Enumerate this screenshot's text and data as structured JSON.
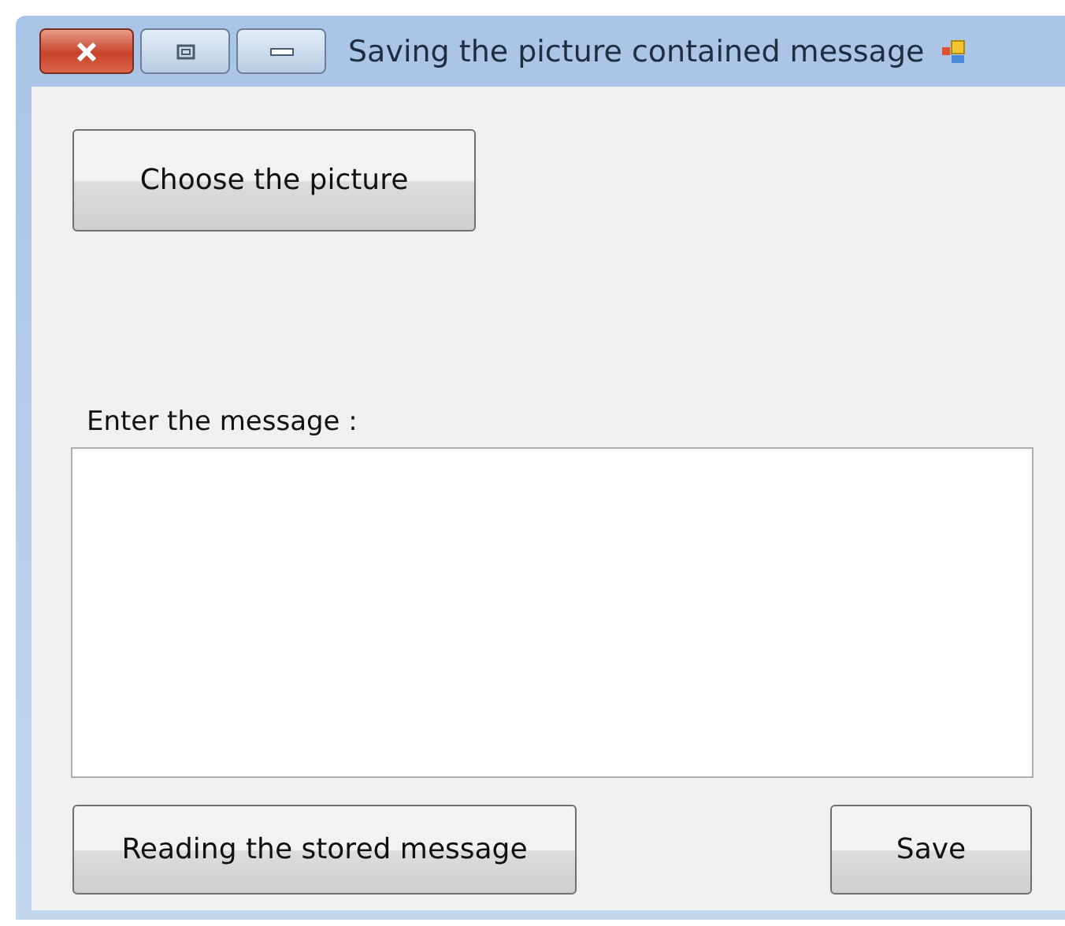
{
  "window": {
    "title": "Saving the picture contained message"
  },
  "choose_button": "Choose the picture",
  "message": {
    "label": "Enter the message :"
  },
  "buttons": [
    "Reading the stored message",
    "Save"
  ]
}
